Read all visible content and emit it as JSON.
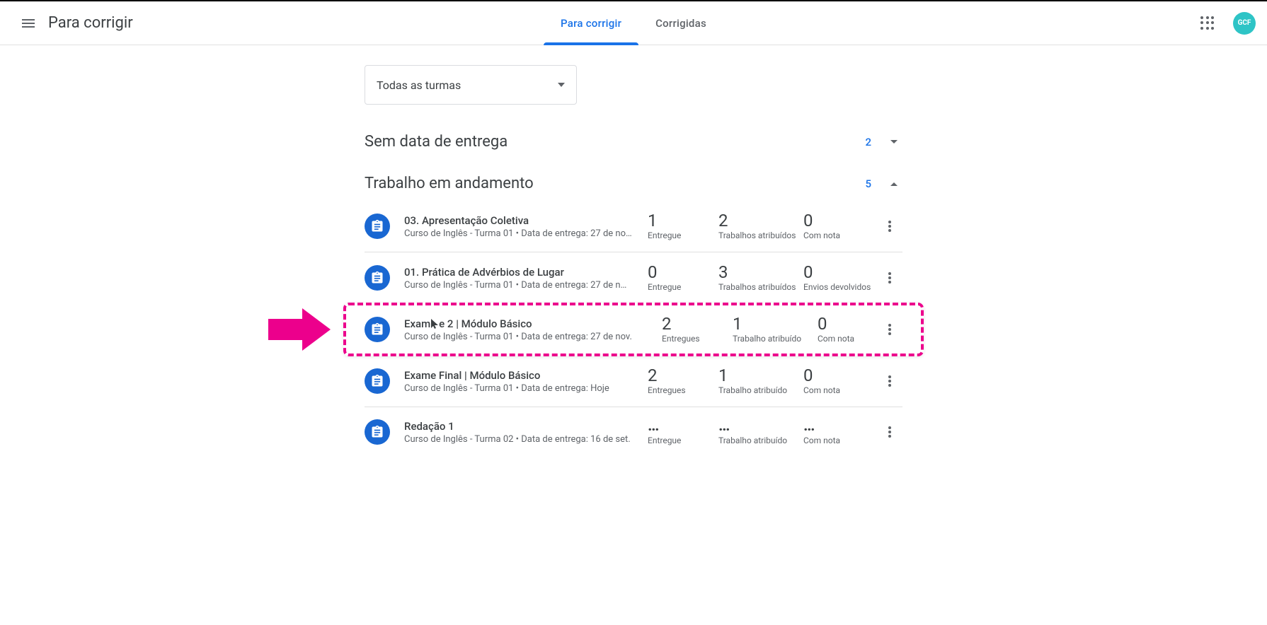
{
  "header": {
    "page_title": "Para corrigir",
    "tabs": {
      "to_review": "Para corrigir",
      "reviewed": "Corrigidas"
    },
    "avatar_text": "GCF"
  },
  "filter": {
    "all_classes": "Todas as turmas"
  },
  "sections": {
    "no_due_date": {
      "title": "Sem data de entrega",
      "count": "2"
    },
    "in_progress": {
      "title": "Trabalho em andamento",
      "count": "5"
    }
  },
  "items": [
    {
      "title": "03. Apresentação Coletiva",
      "subtitle": "Curso de Inglês - Turma 01 • Data de entrega: 27 de no…",
      "s1_num": "1",
      "s1_lbl": "Entregue",
      "s2_num": "2",
      "s2_lbl": "Trabalhos atribuídos",
      "s3_num": "0",
      "s3_lbl": "Com nota"
    },
    {
      "title": "01. Prática de Advérbios de Lugar",
      "subtitle": "Curso de Inglês - Turma 01 • Data de entrega: 27 de n…",
      "s1_num": "0",
      "s1_lbl": "Entregue",
      "s2_num": "3",
      "s2_lbl": "Trabalhos atribuídos",
      "s3_num": "0",
      "s3_lbl": "Envios devolvidos"
    },
    {
      "title_a": "Exam",
      "title_b": "e 2 | Módulo Básico",
      "subtitle": "Curso de Inglês - Turma 01 • Data de entrega: 27 de nov.",
      "s1_num": "2",
      "s1_lbl": "Entregues",
      "s2_num": "1",
      "s2_lbl": "Trabalho atribuído",
      "s3_num": "0",
      "s3_lbl": "Com nota"
    },
    {
      "title": "Exame Final | Módulo Básico",
      "subtitle": "Curso de Inglês - Turma 01 • Data de entrega: Hoje",
      "s1_num": "2",
      "s1_lbl": "Entregues",
      "s2_num": "1",
      "s2_lbl": "Trabalho atribuído",
      "s3_num": "0",
      "s3_lbl": "Com nota"
    },
    {
      "title": "Redação 1",
      "subtitle": "Curso de Inglês - Turma 02 • Data de entrega: 16 de set.",
      "s1_num": "…",
      "s1_lbl": "Entregue",
      "s2_num": "…",
      "s2_lbl": "Trabalho atribuído",
      "s3_num": "…",
      "s3_lbl": "Com nota"
    }
  ]
}
